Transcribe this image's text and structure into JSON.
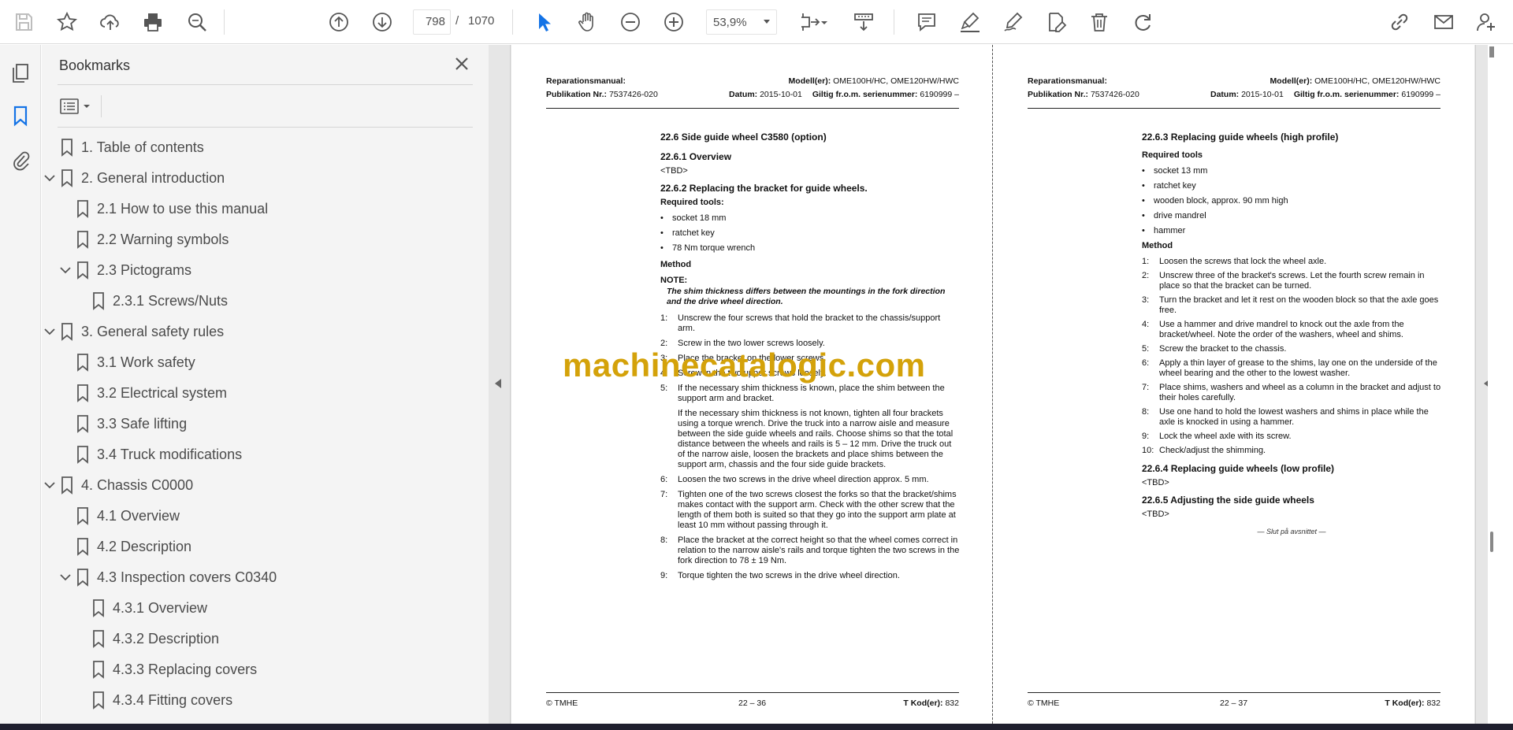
{
  "toolbar": {
    "page_current": "798",
    "page_separator": "/",
    "page_total": "1070",
    "zoom": "53,9%",
    "icons": [
      "save-icon",
      "star-icon",
      "upload-icon",
      "print-icon",
      "zoom-search-icon",
      "page-up-icon",
      "page-down-icon",
      "select-cursor-icon",
      "hand-icon",
      "zoom-out-icon",
      "zoom-in-icon",
      "fit-page-icon",
      "scroll-mode-icon",
      "comment-icon",
      "highlight-icon",
      "sign-icon",
      "edit-icon",
      "delete-icon",
      "rotate-icon",
      "share-link-icon",
      "email-icon",
      "user-icon"
    ]
  },
  "bookmarks": {
    "title": "Bookmarks",
    "items": [
      {
        "label": "1. Table of contents",
        "level": 0,
        "expandable": false
      },
      {
        "label": "2. General introduction",
        "level": 0,
        "expandable": true
      },
      {
        "label": "2.1 How to use this manual",
        "level": 1,
        "expandable": false
      },
      {
        "label": "2.2 Warning symbols",
        "level": 1,
        "expandable": false
      },
      {
        "label": "2.3 Pictograms",
        "level": 1,
        "expandable": true
      },
      {
        "label": "2.3.1 Screws/Nuts",
        "level": 2,
        "expandable": false
      },
      {
        "label": "3. General safety rules",
        "level": 0,
        "expandable": true
      },
      {
        "label": "3.1 Work safety",
        "level": 1,
        "expandable": false
      },
      {
        "label": "3.2 Electrical system",
        "level": 1,
        "expandable": false
      },
      {
        "label": "3.3 Safe lifting",
        "level": 1,
        "expandable": false
      },
      {
        "label": "3.4 Truck modifications",
        "level": 1,
        "expandable": false
      },
      {
        "label": "4. Chassis C0000",
        "level": 0,
        "expandable": true
      },
      {
        "label": "4.1 Overview",
        "level": 1,
        "expandable": false
      },
      {
        "label": "4.2 Description",
        "level": 1,
        "expandable": false
      },
      {
        "label": "4.3 Inspection covers C0340",
        "level": 1,
        "expandable": true
      },
      {
        "label": "4.3.1 Overview",
        "level": 2,
        "expandable": false
      },
      {
        "label": "4.3.2 Description",
        "level": 2,
        "expandable": false
      },
      {
        "label": "4.3.3 Replacing covers",
        "level": 2,
        "expandable": false
      },
      {
        "label": "4.3.4 Fitting covers",
        "level": 2,
        "expandable": false
      }
    ]
  },
  "header": {
    "manual_label": "Reparationsmanual:",
    "pub_label": "Publikation Nr.:",
    "pub_value": "7537426-020",
    "model_label": "Modell(er):",
    "model_value": "OME100H/HC, OME120HW/HWC",
    "date_label": "Datum:",
    "date_value": "2015-10-01",
    "serial_label": "Giltig fr.o.m. serienummer:",
    "serial_value": "6190999 –"
  },
  "page_left": {
    "footer_left": "© TMHE",
    "footer_mid": "22 – 36",
    "footer_right_label": "T Kod(er):",
    "footer_right_value": "832",
    "h1": "22.6 Side guide wheel C3580 (option)",
    "h2": "22.6.1 Overview",
    "tbd1": "<TBD>",
    "h3": "22.6.2 Replacing the bracket for guide wheels.",
    "req_tools": "Required tools:",
    "tools": [
      "socket 18 mm",
      "ratchet key",
      "78 Nm torque wrench"
    ],
    "method": "Method",
    "note_label": "NOTE:",
    "note_text": "The shim thickness differs between the mountings in the fork direction and the drive wheel direction.",
    "steps": [
      {
        "n": "1:",
        "t": "Unscrew the four screws that hold the bracket to the chassis/support arm."
      },
      {
        "n": "2:",
        "t": "Screw in the two lower screws loosely."
      },
      {
        "n": "3:",
        "t": "Place the bracket on the lower screws."
      },
      {
        "n": "4:",
        "t": "Screw in the two upper screws loosely."
      },
      {
        "n": "5:",
        "t": "If the necessary shim thickness is known, place the shim between the support arm and bracket."
      }
    ],
    "step5_extra": "If the necessary shim thickness is not known, tighten all four brackets using a torque wrench. Drive the truck into a narrow aisle and measure between the side guide wheels and rails. Choose shims so that the total distance between the wheels and rails is 5 – 12 mm. Drive the truck out of the narrow aisle, loosen the brackets and place shims between the support arm, chassis and the four side guide brackets.",
    "steps2": [
      {
        "n": "6:",
        "t": "Loosen the two screws in the drive wheel direction approx. 5 mm."
      },
      {
        "n": "7:",
        "t": "Tighten one of the two screws closest the forks so that the bracket/shims makes contact with the support arm. Check with the other screw that the length of them both is suited so that they go into the support arm plate at least 10 mm without passing through it."
      },
      {
        "n": "8:",
        "t": "Place the bracket at the correct height so that the wheel comes correct in relation to the narrow aisle's rails and torque tighten the two screws in the fork direction to 78 ± 19 Nm."
      },
      {
        "n": "9:",
        "t": "Torque tighten the two screws in the drive wheel direction."
      }
    ]
  },
  "page_right": {
    "footer_left": "© TMHE",
    "footer_mid": "22 – 37",
    "footer_right_label": "T Kod(er):",
    "footer_right_value": "832",
    "h1": "22.6.3 Replacing guide wheels (high profile)",
    "req_tools": "Required tools",
    "tools": [
      "socket 13 mm",
      "ratchet key",
      "wooden block, approx. 90 mm high",
      "drive mandrel",
      "hammer"
    ],
    "method": "Method",
    "steps": [
      {
        "n": "1:",
        "t": "Loosen the screws that lock the wheel axle."
      },
      {
        "n": "2:",
        "t": "Unscrew three of the bracket's screws. Let the fourth screw remain in place so that the bracket can be turned."
      },
      {
        "n": "3:",
        "t": "Turn the bracket and let it rest on the wooden block so that the axle goes free."
      },
      {
        "n": "4:",
        "t": "Use a hammer and drive mandrel to knock out the axle from the bracket/wheel. Note the order of the washers, wheel and shims."
      },
      {
        "n": "5:",
        "t": "Screw the bracket to the chassis."
      },
      {
        "n": "6:",
        "t": "Apply a thin layer of grease to the shims, lay one on the underside of the wheel bearing and the other to the lowest washer."
      },
      {
        "n": "7:",
        "t": "Place shims, washers and wheel as a column in the bracket and adjust to their holes carefully."
      },
      {
        "n": "8:",
        "t": "Use one hand to hold the lowest washers and shims in place while  the axle is knocked in using a hammer."
      },
      {
        "n": "9:",
        "t": "Lock the wheel axle with its screw."
      },
      {
        "n": "10:",
        "t": "Check/adjust the shimming."
      }
    ],
    "h2": "22.6.4 Replacing guide wheels (low profile)",
    "tbd2": "<TBD>",
    "h3": "22.6.5 Adjusting the side guide wheels",
    "tbd3": "<TBD>",
    "end": "— Slut på avsnittet —"
  },
  "watermark": "machinecatalogic.com"
}
